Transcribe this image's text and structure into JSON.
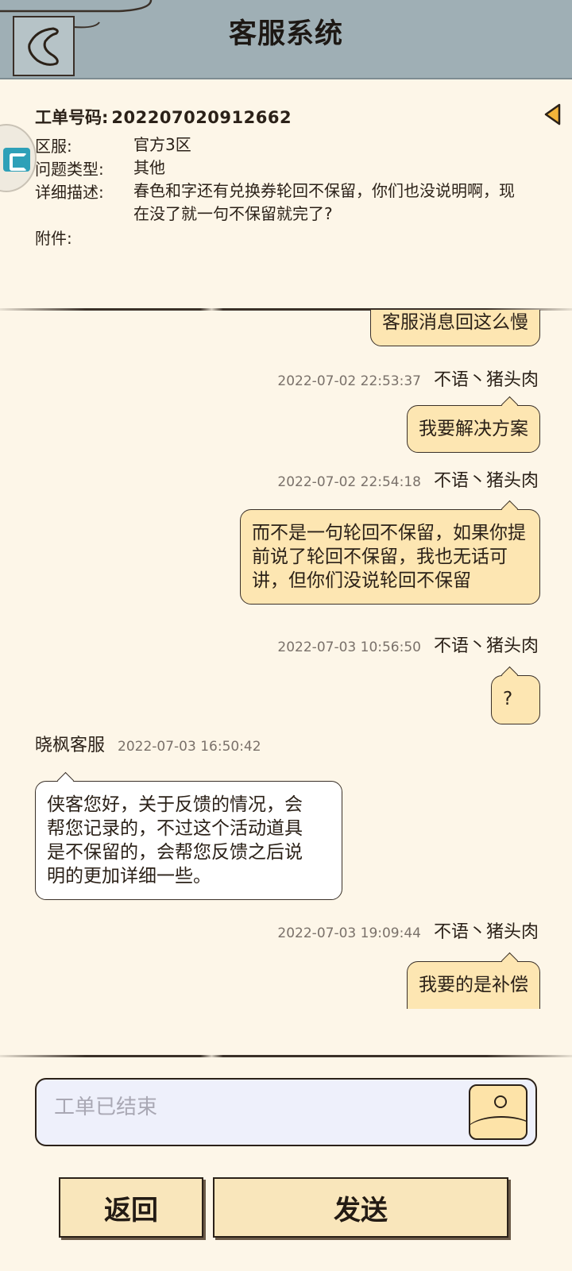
{
  "header": {
    "title": "客服系统"
  },
  "ticket": {
    "number_label": "工单号码:",
    "number_value": "202207020912662",
    "rows": [
      {
        "label": "区服:",
        "value": "官方3区"
      },
      {
        "label": "问题类型:",
        "value": "其他"
      },
      {
        "label": "详细描述:",
        "value": "春色和字还有兑换券轮回不保留，你们也没说明啊，现在没了就一句不保留就完了?"
      },
      {
        "label": "附件:",
        "value": ""
      }
    ]
  },
  "messages": [
    {
      "side": "right",
      "sender": "",
      "time": "",
      "text": "客服消息回这么慢"
    },
    {
      "side": "right",
      "sender": "不语丶猪头肉",
      "time": "2022-07-02 22:53:37",
      "text": "我要解决方案"
    },
    {
      "side": "right",
      "sender": "不语丶猪头肉",
      "time": "2022-07-02 22:54:18",
      "text": "而不是一句轮回不保留，如果你提前说了轮回不保留，我也无话可讲，但你们没说轮回不保留"
    },
    {
      "side": "right",
      "sender": "不语丶猪头肉",
      "time": "2022-07-03 10:56:50",
      "text": "?"
    },
    {
      "side": "left",
      "sender": "晓枫客服",
      "time": "2022-07-03 16:50:42",
      "text": "侠客您好，关于反馈的情况，会帮您记录的，不过这个活动道具是不保留的，会帮您反馈之后说明的更加详细一些。"
    },
    {
      "side": "right",
      "sender": "不语丶猪头肉",
      "time": "2022-07-03 19:09:44",
      "text": "我要的是补偿"
    }
  ],
  "input": {
    "placeholder": "工单已结束"
  },
  "buttons": {
    "back": "返回",
    "send": "发送"
  },
  "icons": {
    "back": "chevron-left-icon",
    "image": "image-icon",
    "collapse": "triangle-left-icon"
  },
  "colors": {
    "header_bg": "#9fafb5",
    "page_bg": "#fdf6e8",
    "my_bubble": "#fde6b2",
    "their_bubble": "#ffffff",
    "button_bg": "#f9e6bb",
    "input_bg": "#eef0fb"
  }
}
